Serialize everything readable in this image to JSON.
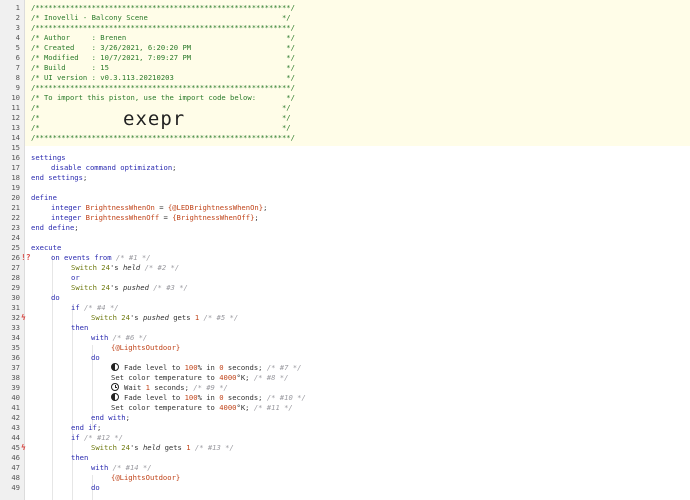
{
  "piston": {
    "big_code": "exepr"
  },
  "lines": [
    {
      "n": "1",
      "parts": [
        [
          "c",
          "/***********************************************************/"
        ]
      ]
    },
    {
      "n": "2",
      "parts": [
        [
          "c",
          "/* Inovelli - Balcony Scene                               */"
        ]
      ]
    },
    {
      "n": "3",
      "parts": [
        [
          "c",
          "/***********************************************************/"
        ]
      ]
    },
    {
      "n": "4",
      "parts": [
        [
          "c",
          "/* Author     : Brenen                                     */"
        ]
      ]
    },
    {
      "n": "5",
      "parts": [
        [
          "c",
          "/* Created    : 3/26/2021, 6:20:20 PM                      */"
        ]
      ]
    },
    {
      "n": "6",
      "parts": [
        [
          "c",
          "/* Modified   : 10/7/2021, 7:09:27 PM                      */"
        ]
      ]
    },
    {
      "n": "7",
      "parts": [
        [
          "c",
          "/* Build      : 15                                         */"
        ]
      ]
    },
    {
      "n": "8",
      "parts": [
        [
          "c",
          "/* UI version : v0.3.113.20210203                          */"
        ]
      ]
    },
    {
      "n": "9",
      "parts": [
        [
          "c",
          "/***********************************************************/"
        ]
      ]
    },
    {
      "n": "10",
      "parts": [
        [
          "c",
          "/* To import this piston, use the import code below:       */"
        ]
      ]
    },
    {
      "n": "11",
      "parts": [
        [
          "c",
          "/*                                                        */"
        ]
      ]
    },
    {
      "n": "12",
      "parts": [
        [
          "c",
          "/*                                                        */"
        ]
      ]
    },
    {
      "n": "13",
      "parts": [
        [
          "c",
          "/*                                                        */"
        ]
      ]
    },
    {
      "n": "14",
      "parts": [
        [
          "c",
          "/***********************************************************/"
        ]
      ]
    },
    {
      "n": "15",
      "parts": []
    },
    {
      "n": "16",
      "parts": [
        [
          "kw",
          "settings"
        ]
      ]
    },
    {
      "n": "17",
      "indent": 1,
      "parts": [
        [
          "kw",
          "disable command optimization"
        ],
        [
          "tx",
          ";"
        ]
      ]
    },
    {
      "n": "18",
      "parts": [
        [
          "kw",
          "end settings"
        ],
        [
          "tx",
          ";"
        ]
      ]
    },
    {
      "n": "19",
      "parts": []
    },
    {
      "n": "20",
      "parts": [
        [
          "kw",
          "define"
        ]
      ]
    },
    {
      "n": "21",
      "indent": 1,
      "parts": [
        [
          "ty",
          "integer "
        ],
        [
          "vr",
          "BrightnessWhenOn"
        ],
        [
          "tx",
          " = "
        ],
        [
          "vr",
          "{@LEDBrightnessWhenOn}"
        ],
        [
          "tx",
          ";"
        ]
      ]
    },
    {
      "n": "22",
      "indent": 1,
      "parts": [
        [
          "ty",
          "integer "
        ],
        [
          "vr",
          "BrightnessWhenOff"
        ],
        [
          "tx",
          " = "
        ],
        [
          "vr",
          "{BrightnessWhenOff}"
        ],
        [
          "tx",
          ";"
        ]
      ]
    },
    {
      "n": "23",
      "parts": [
        [
          "kw",
          "end define"
        ],
        [
          "tx",
          ";"
        ]
      ]
    },
    {
      "n": "24",
      "parts": []
    },
    {
      "n": "25",
      "parts": [
        [
          "kw",
          "execute"
        ]
      ]
    },
    {
      "n": "26",
      "mk": "!?",
      "indent": 1,
      "parts": [
        [
          "kw",
          "on events from "
        ],
        [
          "cm",
          "/* #1 */"
        ]
      ]
    },
    {
      "n": "27",
      "indent": 2,
      "parts": [
        [
          "dv",
          "Switch 24"
        ],
        [
          "tx",
          "'s "
        ],
        [
          "at",
          "held"
        ],
        [
          "cm",
          " /* #2 */"
        ]
      ]
    },
    {
      "n": "28",
      "indent": 2,
      "parts": [
        [
          "kw",
          "or"
        ]
      ]
    },
    {
      "n": "29",
      "indent": 2,
      "parts": [
        [
          "dv",
          "Switch 24"
        ],
        [
          "tx",
          "'s "
        ],
        [
          "at",
          "pushed"
        ],
        [
          "cm",
          " /* #3 */"
        ]
      ]
    },
    {
      "n": "30",
      "indent": 1,
      "parts": [
        [
          "kw",
          "do"
        ]
      ]
    },
    {
      "n": "31",
      "indent": 2,
      "parts": [
        [
          "kw",
          "if "
        ],
        [
          "cm",
          "/* #4 */"
        ]
      ]
    },
    {
      "n": "32",
      "mk": "ϟ",
      "indent": 3,
      "parts": [
        [
          "dv",
          "Switch 24"
        ],
        [
          "tx",
          "'s "
        ],
        [
          "at",
          "pushed"
        ],
        [
          "tx",
          " gets "
        ],
        [
          "nm",
          "1"
        ],
        [
          "cm",
          " /* #5 */"
        ]
      ]
    },
    {
      "n": "33",
      "indent": 2,
      "parts": [
        [
          "kw",
          "then"
        ]
      ]
    },
    {
      "n": "34",
      "indent": 3,
      "parts": [
        [
          "kw",
          "with "
        ],
        [
          "cm",
          "/* #6 */"
        ]
      ]
    },
    {
      "n": "35",
      "indent": 4,
      "parts": [
        [
          "vr",
          "{@LightsOutdoor}"
        ]
      ]
    },
    {
      "n": "36",
      "indent": 3,
      "parts": [
        [
          "kw",
          "do"
        ]
      ]
    },
    {
      "n": "37",
      "indent": 4,
      "icon": "half",
      "parts": [
        [
          "tx",
          "Fade level to "
        ],
        [
          "nm",
          "100"
        ],
        [
          "tx",
          "% in "
        ],
        [
          "nm",
          "0"
        ],
        [
          "tx",
          " seconds; "
        ],
        [
          "cm",
          "/* #7 */"
        ]
      ]
    },
    {
      "n": "38",
      "indent": 4,
      "parts": [
        [
          "tx",
          "Set color temperature to "
        ],
        [
          "nm",
          "4000"
        ],
        [
          "tx",
          "°K; "
        ],
        [
          "cm",
          "/* #8 */"
        ]
      ]
    },
    {
      "n": "39",
      "indent": 4,
      "icon": "clock",
      "parts": [
        [
          "tx",
          "Wait "
        ],
        [
          "nm",
          "1"
        ],
        [
          "tx",
          " seconds; "
        ],
        [
          "cm",
          "/* #9 */"
        ]
      ]
    },
    {
      "n": "40",
      "indent": 4,
      "icon": "half",
      "parts": [
        [
          "tx",
          "Fade level to "
        ],
        [
          "nm",
          "100"
        ],
        [
          "tx",
          "% in "
        ],
        [
          "nm",
          "0"
        ],
        [
          "tx",
          " seconds; "
        ],
        [
          "cm",
          "/* #10 */"
        ]
      ]
    },
    {
      "n": "41",
      "indent": 4,
      "parts": [
        [
          "tx",
          "Set color temperature to "
        ],
        [
          "nm",
          "4000"
        ],
        [
          "tx",
          "°K; "
        ],
        [
          "cm",
          "/* #11 */"
        ]
      ]
    },
    {
      "n": "42",
      "indent": 3,
      "parts": [
        [
          "kw",
          "end with"
        ],
        [
          "tx",
          ";"
        ]
      ]
    },
    {
      "n": "43",
      "indent": 2,
      "parts": [
        [
          "kw",
          "end if"
        ],
        [
          "tx",
          ";"
        ]
      ]
    },
    {
      "n": "44",
      "indent": 2,
      "parts": [
        [
          "kw",
          "if "
        ],
        [
          "cm",
          "/* #12 */"
        ]
      ]
    },
    {
      "n": "45",
      "mk": "ϟ",
      "indent": 3,
      "parts": [
        [
          "dv",
          "Switch 24"
        ],
        [
          "tx",
          "'s "
        ],
        [
          "at",
          "held"
        ],
        [
          "tx",
          " gets "
        ],
        [
          "nm",
          "1"
        ],
        [
          "cm",
          " /* #13 */"
        ]
      ]
    },
    {
      "n": "46",
      "indent": 2,
      "parts": [
        [
          "kw",
          "then"
        ]
      ]
    },
    {
      "n": "47",
      "indent": 3,
      "parts": [
        [
          "kw",
          "with "
        ],
        [
          "cm",
          "/* #14 */"
        ]
      ]
    },
    {
      "n": "48",
      "indent": 4,
      "parts": [
        [
          "vr",
          "{@LightsOutdoor}"
        ]
      ]
    },
    {
      "n": "49",
      "indent": 3,
      "parts": [
        [
          "kw",
          "do"
        ]
      ]
    }
  ]
}
